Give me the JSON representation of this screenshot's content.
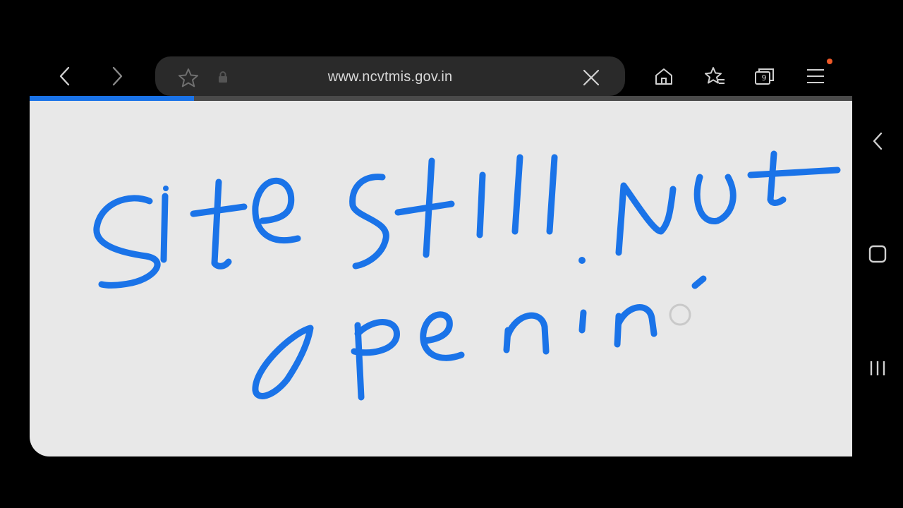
{
  "browser": {
    "url": "www.ncvtmis.gov.in",
    "tab_count": "9",
    "load_progress": 0.2
  },
  "page": {
    "handwritten_text": [
      "Site still Not",
      "openin'"
    ],
    "ink_color": "#1a73e8",
    "background_color": "#e8e8e8"
  },
  "icons": {
    "back": "chevron-left-icon",
    "forward": "chevron-right-icon",
    "bookmark": "star-icon",
    "secure": "lock-icon",
    "close": "close-icon",
    "home": "home-icon",
    "bookmarks_list": "star-list-icon",
    "tabs": "tabs-icon",
    "menu": "hamburger-menu-icon",
    "system_back": "system-back-icon",
    "system_home": "system-home-icon",
    "system_recents": "system-recents-icon"
  }
}
